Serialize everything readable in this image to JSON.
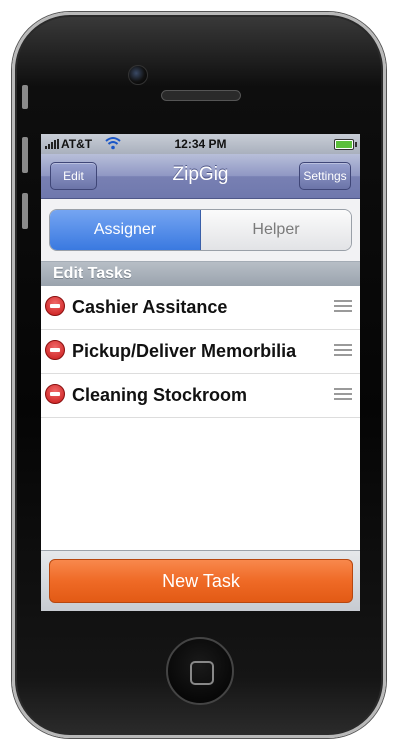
{
  "status_bar": {
    "carrier": "AT&T",
    "time": "12:34 PM"
  },
  "nav_bar": {
    "title": "ZipGig",
    "edit_label": "Edit",
    "settings_label": "Settings"
  },
  "segmented": {
    "options": [
      "Assigner",
      "Helper"
    ],
    "selected": "Assigner"
  },
  "section": {
    "header": "Edit Tasks"
  },
  "tasks": [
    {
      "label": "Cashier Assitance"
    },
    {
      "label": "Pickup/Deliver Memorbilia"
    },
    {
      "label": "Cleaning Stockroom"
    }
  ],
  "bottom": {
    "new_task_label": "New Task"
  },
  "colors": {
    "navbar": "#7880b3",
    "segment_active": "#3a79e0",
    "new_task_button": "#ef6a26",
    "delete_icon": "#c81818"
  }
}
